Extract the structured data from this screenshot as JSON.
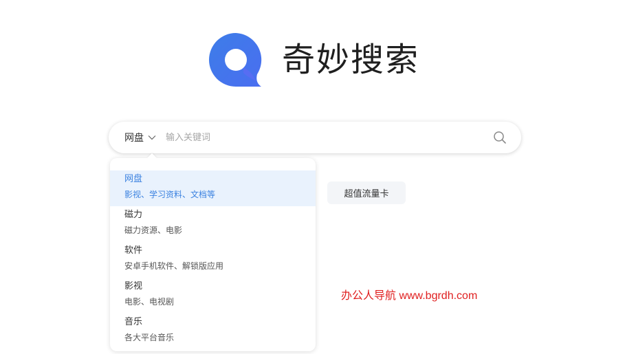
{
  "brand": {
    "title": "奇妙搜索",
    "logo_icon": "q-logo-icon",
    "accent_color": "#3b82e0"
  },
  "search": {
    "category_label": "网盘",
    "placeholder": "输入关键词",
    "value": "",
    "chevron_icon": "chevron-down-icon",
    "search_icon": "search-icon"
  },
  "dropdown": {
    "items": [
      {
        "title": "网盘",
        "desc": "影视、学习资料、文档等",
        "active": true
      },
      {
        "title": "磁力",
        "desc": "磁力资源、电影",
        "active": false
      },
      {
        "title": "软件",
        "desc": "安卓手机软件、解锁版应用",
        "active": false
      },
      {
        "title": "影视",
        "desc": "电影、电视剧",
        "active": false
      },
      {
        "title": "音乐",
        "desc": "各大平台音乐",
        "active": false
      }
    ]
  },
  "promo": {
    "label": "超值流量卡"
  },
  "watermark": {
    "text": "办公人导航  www.bgrdh.com",
    "color": "#e02020"
  }
}
